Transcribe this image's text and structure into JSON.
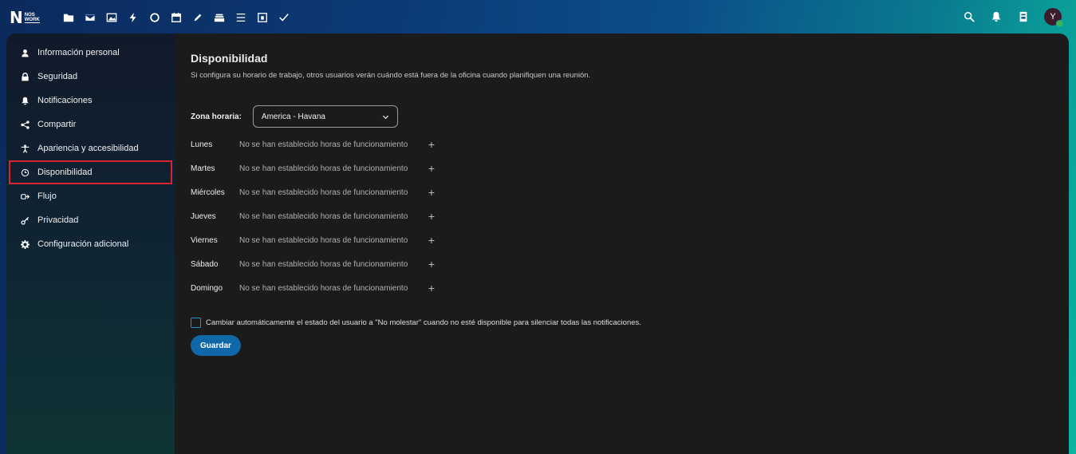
{
  "brand": {
    "letter": "N",
    "line1": "NOS",
    "line2": "WORK"
  },
  "topbar": {
    "apps": [
      {
        "name": "files-icon"
      },
      {
        "name": "mail-icon"
      },
      {
        "name": "photos-icon"
      },
      {
        "name": "activity-icon"
      },
      {
        "name": "talk-icon"
      },
      {
        "name": "calendar-icon"
      },
      {
        "name": "notes-icon"
      },
      {
        "name": "deck-icon"
      },
      {
        "name": "tasks-icon"
      },
      {
        "name": "contacts-icon"
      },
      {
        "name": "checkmark-icon"
      }
    ],
    "avatar_letter": "Y"
  },
  "sidebar": {
    "items": [
      {
        "label": "Información personal",
        "icon": "user-icon"
      },
      {
        "label": "Seguridad",
        "icon": "lock-icon"
      },
      {
        "label": "Notificaciones",
        "icon": "bell-icon"
      },
      {
        "label": "Compartir",
        "icon": "share-icon"
      },
      {
        "label": "Apariencia y accesibilidad",
        "icon": "accessibility-icon"
      },
      {
        "label": "Disponibilidad",
        "icon": "clock-icon",
        "active": true
      },
      {
        "label": "Flujo",
        "icon": "flow-icon"
      },
      {
        "label": "Privacidad",
        "icon": "key-icon"
      },
      {
        "label": "Configuración adicional",
        "icon": "gear-icon"
      }
    ]
  },
  "main": {
    "title": "Disponibilidad",
    "description": "Si configura su horario de trabajo, otros usuarios verán cuándo está fuera de la oficina cuando planifiquen una reunión.",
    "timezone_label": "Zona horaria:",
    "timezone_value": "America - Havana",
    "days": [
      {
        "name": "Lunes",
        "status": "No se han establecido horas de funcionamiento"
      },
      {
        "name": "Martes",
        "status": "No se han establecido horas de funcionamiento"
      },
      {
        "name": "Miércoles",
        "status": "No se han establecido horas de funcionamiento"
      },
      {
        "name": "Jueves",
        "status": "No se han establecido horas de funcionamiento"
      },
      {
        "name": "Viernes",
        "status": "No se han establecido horas de funcionamiento"
      },
      {
        "name": "Sábado",
        "status": "No se han establecido horas de funcionamiento"
      },
      {
        "name": "Domingo",
        "status": "No se han establecido horas de funcionamiento"
      }
    ],
    "add_symbol": "+",
    "dnd_label": "Cambiar automáticamente el estado del usuario a \"No molestar\" cuando no esté disponible para silenciar todas las notificaciones.",
    "save_label": "Guardar"
  }
}
